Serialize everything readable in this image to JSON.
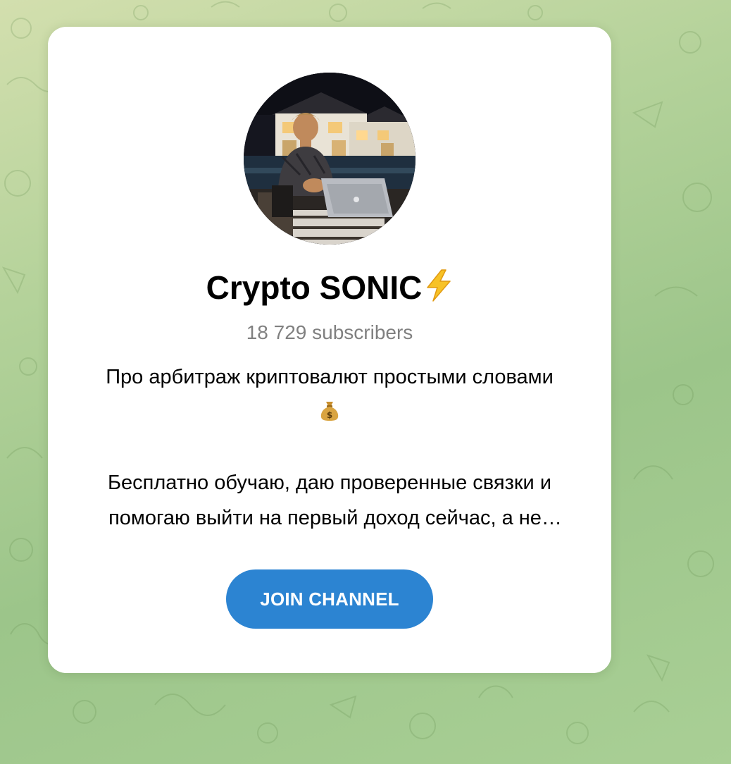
{
  "channel": {
    "title": "Crypto SONIC",
    "title_emoji_icon": "high-voltage-emoji",
    "subscribers": "18 729 subscribers",
    "description_line1": "Про арбитраж криптовалют простыми словами",
    "description_emoji_icon": "money-bag-emoji",
    "description_line2": "Бесплатно обучаю, даю проверенные связки и",
    "description_line3": "помогаю выйти на первый доход сейчас, а не…"
  },
  "join_button": {
    "label": "JOIN CHANNEL",
    "color": "#2c84d2"
  },
  "colors": {
    "background_gradient": [
      "#d3dfae",
      "#9cc58a"
    ],
    "card": "#ffffff",
    "subtitle_text": "#808080"
  }
}
